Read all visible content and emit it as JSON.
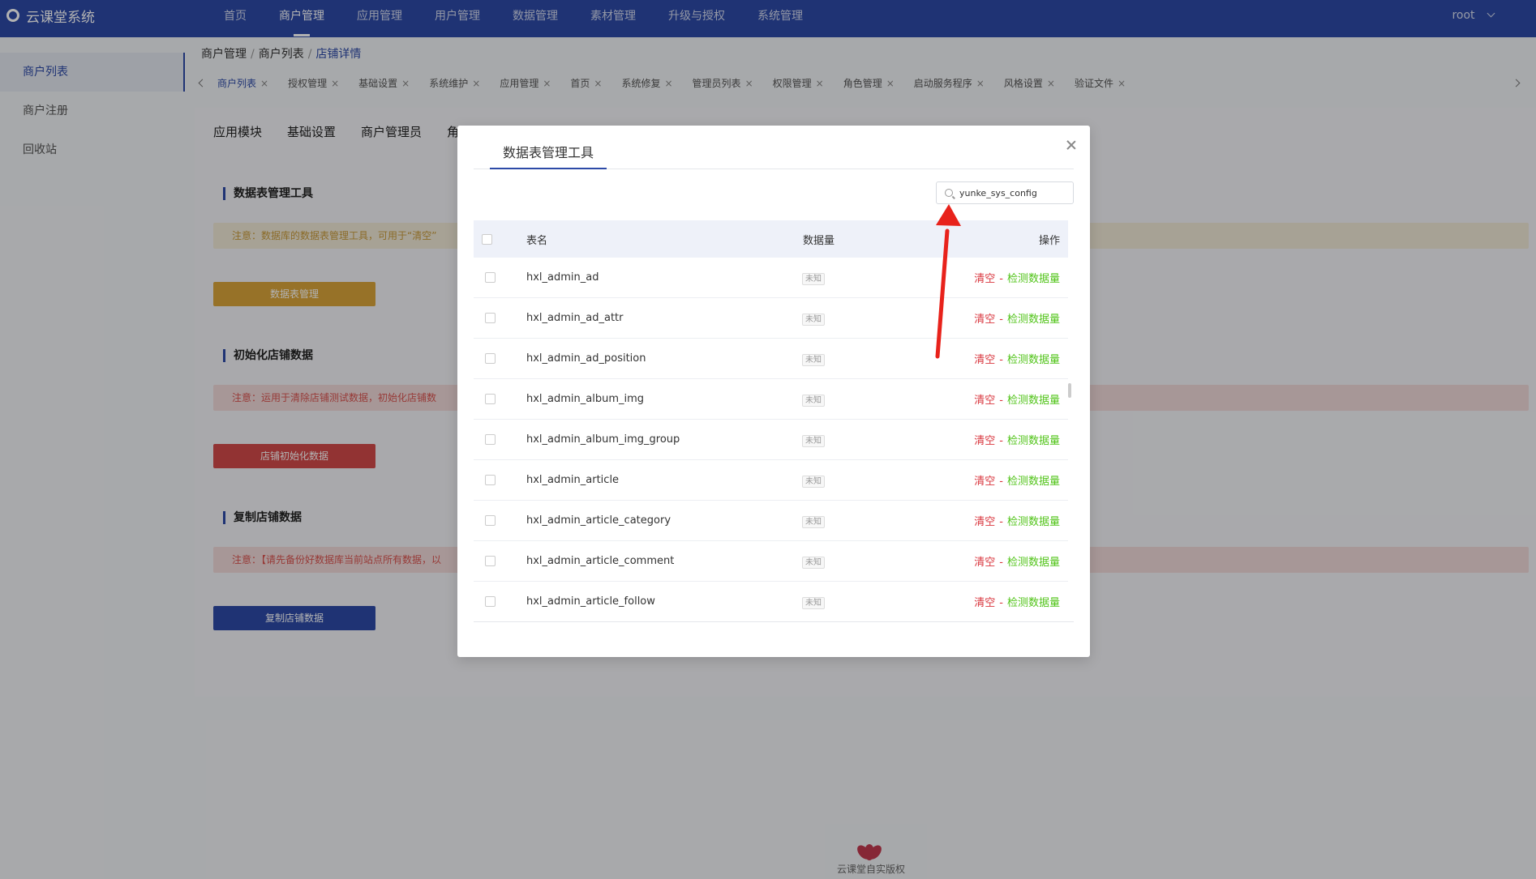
{
  "app": {
    "title": "云课堂系统"
  },
  "nav": [
    "首页",
    "商户管理",
    "应用管理",
    "用户管理",
    "数据管理",
    "素材管理",
    "升级与授权",
    "系统管理"
  ],
  "user": {
    "name": "root"
  },
  "sidebar": [
    "商户列表",
    "商户注册",
    "回收站"
  ],
  "breadcrumb": {
    "level1": "商户管理",
    "level2": "商户列表",
    "current": "店铺详情"
  },
  "tabs": [
    "商户列表",
    "授权管理",
    "基础设置",
    "系统维护",
    "应用管理",
    "首页",
    "系统修复",
    "管理员列表",
    "权限管理",
    "角色管理",
    "启动服务程序",
    "风格设置",
    "验证文件"
  ],
  "subtabs": [
    "应用模块",
    "基础设置",
    "商户管理员",
    "角"
  ],
  "sections": {
    "s1": {
      "title": "数据表管理工具",
      "notice": "注意：数据库的数据表管理工具，可用于“清空”",
      "button": "数据表管理"
    },
    "s2": {
      "title": "初始化店铺数据",
      "notice": "注意：运用于清除店铺测试数据，初始化店铺数",
      "button": "店铺初始化数据"
    },
    "s3": {
      "title": "复制店铺数据",
      "notice": "注意：【请先备份好数据库当前站点所有数据，以",
      "button": "复制店铺数据"
    }
  },
  "footer": {
    "text": "云课堂自实版权"
  },
  "modal": {
    "tab": "数据表管理工具",
    "search": {
      "value": "yunke_sys_config"
    },
    "columns": {
      "name": "表名",
      "count": "数据量",
      "ops": "操作"
    },
    "rows": [
      {
        "name": "hxl_admin_ad",
        "count": "未知"
      },
      {
        "name": "hxl_admin_ad_attr",
        "count": "未知"
      },
      {
        "name": "hxl_admin_ad_position",
        "count": "未知"
      },
      {
        "name": "hxl_admin_album_img",
        "count": "未知"
      },
      {
        "name": "hxl_admin_album_img_group",
        "count": "未知"
      },
      {
        "name": "hxl_admin_article",
        "count": "未知"
      },
      {
        "name": "hxl_admin_article_category",
        "count": "未知"
      },
      {
        "name": "hxl_admin_article_comment",
        "count": "未知"
      },
      {
        "name": "hxl_admin_article_follow",
        "count": "未知"
      }
    ],
    "ops": {
      "clear": "清空",
      "sep": "-",
      "check": "检测数据量"
    }
  },
  "colors": {
    "primary": "#2d4aa7",
    "danger": "#d9363e",
    "success": "#52c41a",
    "arrow": "#e8221b"
  }
}
